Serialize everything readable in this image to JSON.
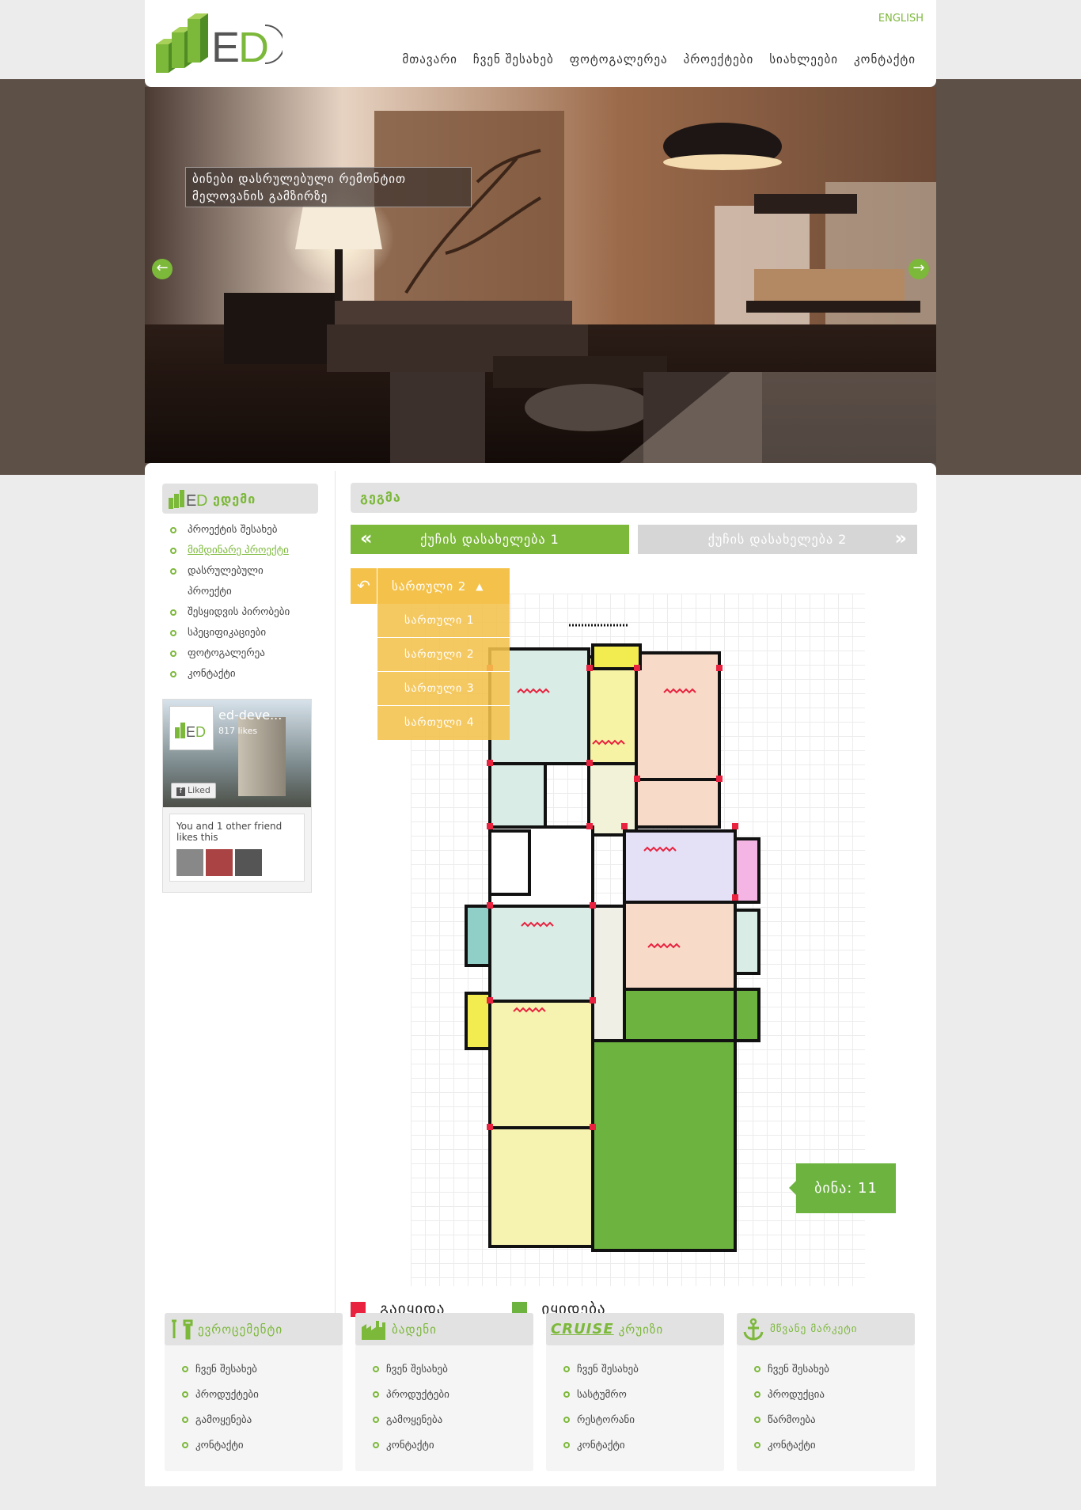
{
  "header": {
    "lang": "ENGLISH",
    "nav": [
      "მთავარი",
      "ჩვენ შესახებ",
      "ფოტოგალერეა",
      "პროექტები",
      "სიახლეები",
      "კონტაქტი"
    ]
  },
  "hero": {
    "caption_line1": "ბინები დასრულებული რემონტით",
    "caption_line2": "მელოვანის გამზირზე"
  },
  "sidebar": {
    "title": "ედემი",
    "items": [
      "პროექტის შესახებ",
      "მიმდინარე პროექტი",
      "დასრულებული",
      "პროექტი",
      "შესყიდვის პირობები",
      "სპეციფიკაციები",
      "ფოტოგალერეა",
      "კონტაქტი"
    ],
    "active_index": 1
  },
  "facebook": {
    "page_name": "ed-deve...",
    "likes": "817 likes",
    "button": "Liked",
    "friends_line1": "You and 1 other friend",
    "friends_line2": "likes this"
  },
  "plan": {
    "title": "გეგმა",
    "building_tab1": "ქუჩის დასახელება 1",
    "building_tab2": "ქუჩის დასახელება 2",
    "current_floor": "სართული 2",
    "floors": [
      "სართული 1",
      "სართული 2",
      "სართული 3",
      "სართული 4"
    ],
    "tooltip": "ბინა: 11",
    "legend_sold": "გაიყიდა",
    "legend_for_sale": "იყიდება",
    "sold_color": "#e8223f",
    "for_sale_color": "#6db33f"
  },
  "blocks": [
    {
      "title": "ევროცემენტი",
      "icon": "tools-icon",
      "items": [
        "ჩვენ შესახებ",
        "პროდუქტები",
        "გამოყენება",
        "კონტაქტი"
      ]
    },
    {
      "title": "ბადენი",
      "icon": "factory-icon",
      "items": [
        "ჩვენ შესახებ",
        "პროდუქტები",
        "გამოყენება",
        "კონტაქტი"
      ]
    },
    {
      "title": "კრუიზი",
      "logo_text": "CRUISE",
      "icon": "cruise-logo",
      "items": [
        "ჩვენ შესახებ",
        "სასტუმრო",
        "რესტორანი",
        "კონტაქტი"
      ]
    },
    {
      "title": "მწვანე მარკეტი",
      "icon": "anchor-icon",
      "items": [
        "ჩვენ შესახებ",
        "პროდუქცია",
        "წარმოება",
        "კონტაქტი"
      ]
    }
  ],
  "colors": {
    "accent": "#7cb83a",
    "floor": "#f4c24b"
  }
}
